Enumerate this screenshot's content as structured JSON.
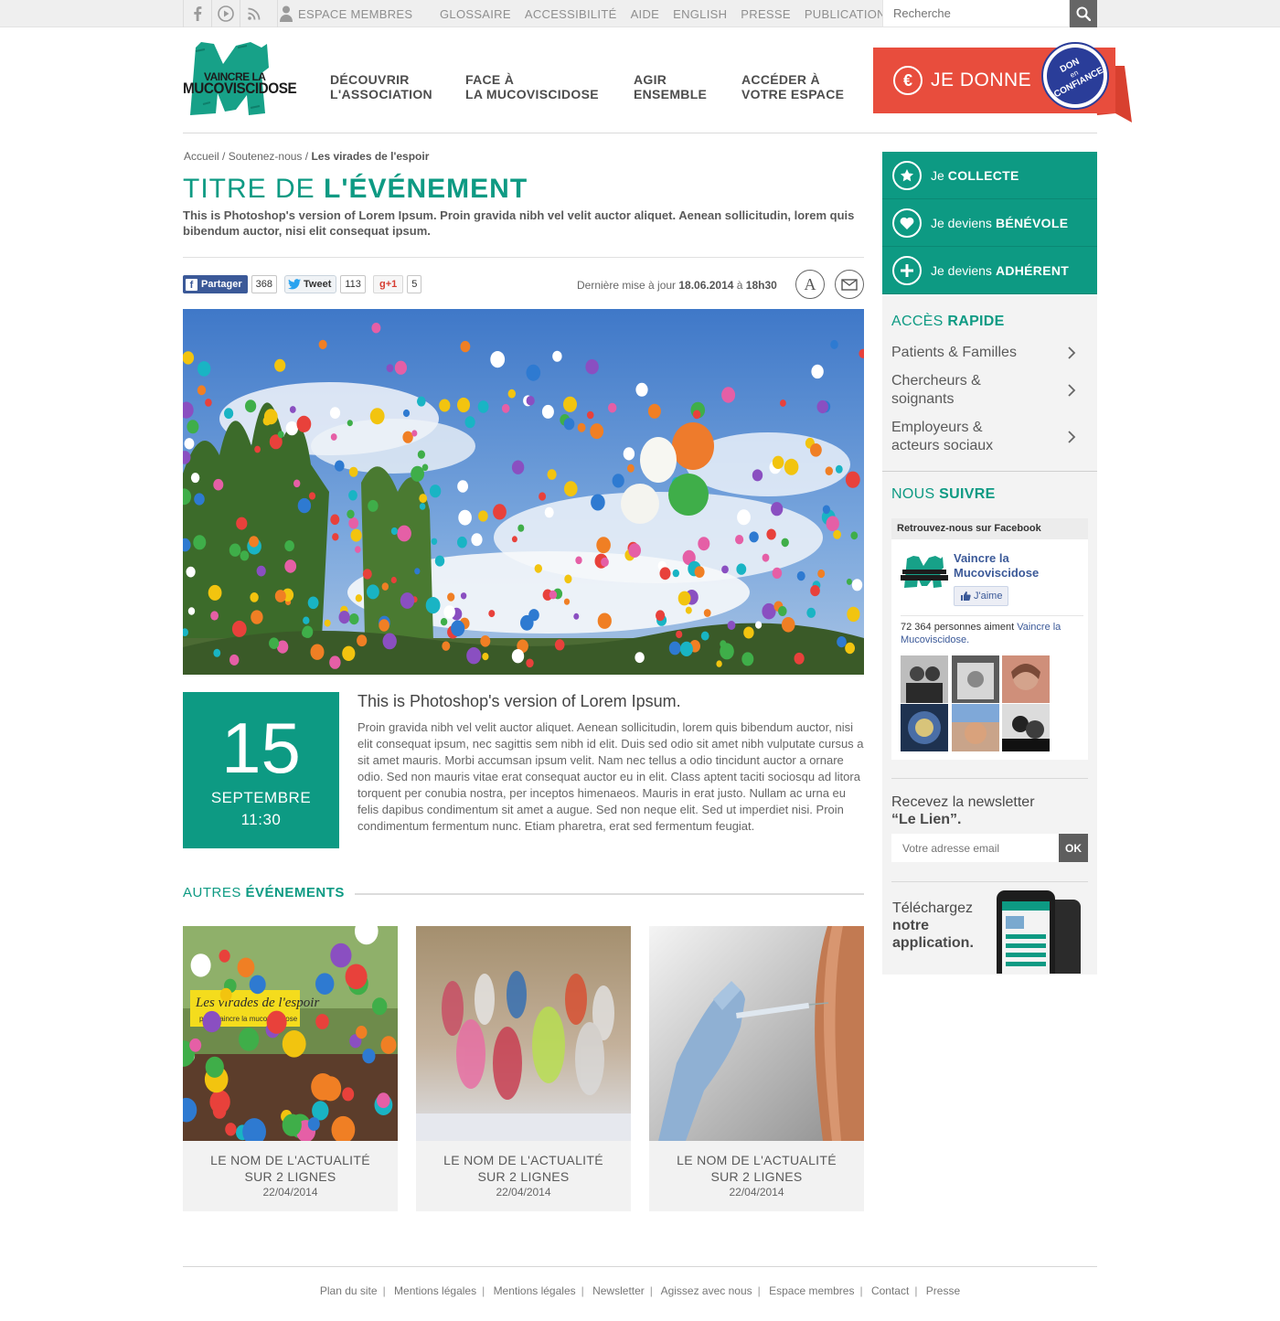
{
  "topbar": {
    "social_icons": [
      "facebook-icon",
      "play-icon",
      "rss-icon"
    ],
    "member_label": "ESPACE MEMBRES",
    "links": [
      "GLOSSAIRE",
      "ACCESSIBILITÉ",
      "AIDE",
      "ENGLISH",
      "PRESSE",
      "PUBLICATIONS"
    ],
    "search_placeholder": "Recherche"
  },
  "header": {
    "logo_line1": "VAINCRE LA",
    "logo_line2": "MUCOVISCIDOSE",
    "nav": [
      {
        "line1": "DÉCOUVRIR",
        "line2": "L'ASSOCIATION"
      },
      {
        "line1": "FACE À",
        "line2": "LA MUCOVISCIDOSE"
      },
      {
        "line1": "AGIR",
        "line2": "ENSEMBLE"
      },
      {
        "line1": "ACCÉDER À",
        "line2": "VOTRE ESPACE"
      }
    ],
    "donate_label": "JE DONNE",
    "seal_line1": "DON",
    "seal_line2": "en",
    "seal_line3": "CONFIANCE",
    "colors": {
      "brand": "#0d9a83",
      "donate": "#e84d3d",
      "seal": "#2a3d99"
    }
  },
  "breadcrumb": {
    "items": [
      "Accueil",
      "Soutenez-nous"
    ],
    "current": "Les virades de l'espoir"
  },
  "article": {
    "title_light": "TITRE DE ",
    "title_bold": "L'ÉVÉNEMENT",
    "lead": "This is Photoshop's version  of Lorem Ipsum. Proin gravida nibh vel velit auctor aliquet. Aenean sollicitudin, lorem quis bibendum auctor, nisi elit consequat ipsum.",
    "share": {
      "facebook_label": "Partager",
      "facebook_count": "368",
      "twitter_label": "Tweet",
      "twitter_count": "113",
      "gplus_label": "g+1",
      "gplus_count": "5"
    },
    "updated_prefix": "Dernière mise à jour ",
    "updated_date": "18.06.2014",
    "updated_mid": " à ",
    "updated_time": "18h30",
    "event": {
      "day": "15",
      "month": "SEPTEMBRE",
      "time": "11:30",
      "subtitle": "This is Photoshop's version of Lorem Ipsum.",
      "body": "Proin gravida nibh vel velit auctor aliquet. Aenean sollicitudin, lorem quis bibendum auctor, nisi elit consequat ipsum, nec sagittis sem nibh id elit. Duis sed odio sit amet nibh vulputate cursus a sit amet mauris. Morbi accumsan ipsum velit. Nam nec tellus a odio tincidunt auctor a ornare odio. Sed non  mauris vitae erat consequat auctor eu in elit. Class aptent taciti sociosqu ad litora torquent per conubia nostra, per inceptos himenaeos. Mauris in erat justo. Nullam ac urna eu felis dapibus condimentum sit amet a augue. Sed non neque elit. Sed ut imperdiet nisi. Proin condimentum fermentum nunc. Etiam pharetra, erat sed fermentum feugiat."
    }
  },
  "others": {
    "title_light": "AUTRES ",
    "title_bold": "ÉVÉNEMENTS",
    "cards": [
      {
        "line1": "LE NOM DE L'ACTUALITÉ",
        "line2": "SUR 2 LIGNES",
        "date": "22/04/2014",
        "banner": "Les virades de l'espoir",
        "banner_sub": "pour vaincre la mucoviscidose"
      },
      {
        "line1": "LE NOM DE L'ACTUALITÉ",
        "line2": "SUR 2 LIGNES",
        "date": "22/04/2014"
      },
      {
        "line1": "LE NOM DE L'ACTUALITÉ",
        "line2": "SUR 2 LIGNES",
        "date": "22/04/2014"
      }
    ]
  },
  "sidebar": {
    "actions": [
      {
        "prefix": "Je ",
        "bold": "COLLECTE",
        "icon": "star-icon"
      },
      {
        "prefix": "Je deviens ",
        "bold": "BÉNÉVOLE",
        "icon": "heart-icon"
      },
      {
        "prefix": "Je deviens ",
        "bold": "ADHÉRENT",
        "icon": "plus-icon"
      }
    ],
    "quick_title_light": "ACCÈS ",
    "quick_title_bold": "RAPIDE",
    "quick_links": [
      {
        "line1": "Patients & Familles",
        "line2": ""
      },
      {
        "line1": "Chercheurs &",
        "line2": "soignants"
      },
      {
        "line1": "Employeurs &",
        "line2": "acteurs sociaux"
      }
    ],
    "follow_title_light": "NOUS ",
    "follow_title_bold": "SUIVRE",
    "facebook": {
      "header": "Retrouvez-nous sur Facebook",
      "page_name_1": "Vaincre la",
      "page_name_2": "Mucoviscidose",
      "like_label": "J'aime",
      "count_text": "72 364 personnes aiment ",
      "count_link_1": "Vaincre la",
      "count_link_2": "Mucoviscidose."
    },
    "newsletter_line1": "Recevez la newsletter",
    "newsletter_line2": "“Le Lien”.",
    "newsletter_placeholder": "Votre adresse email",
    "newsletter_button": "OK",
    "app_line1": "Téléchargez",
    "app_line2": "notre",
    "app_line3": "application."
  },
  "footer": {
    "links": [
      "Plan du site",
      "Mentions légales",
      "Mentions légales",
      "Newsletter",
      "Agissez avec nous",
      "Espace membres",
      "Contact",
      "Presse"
    ]
  }
}
